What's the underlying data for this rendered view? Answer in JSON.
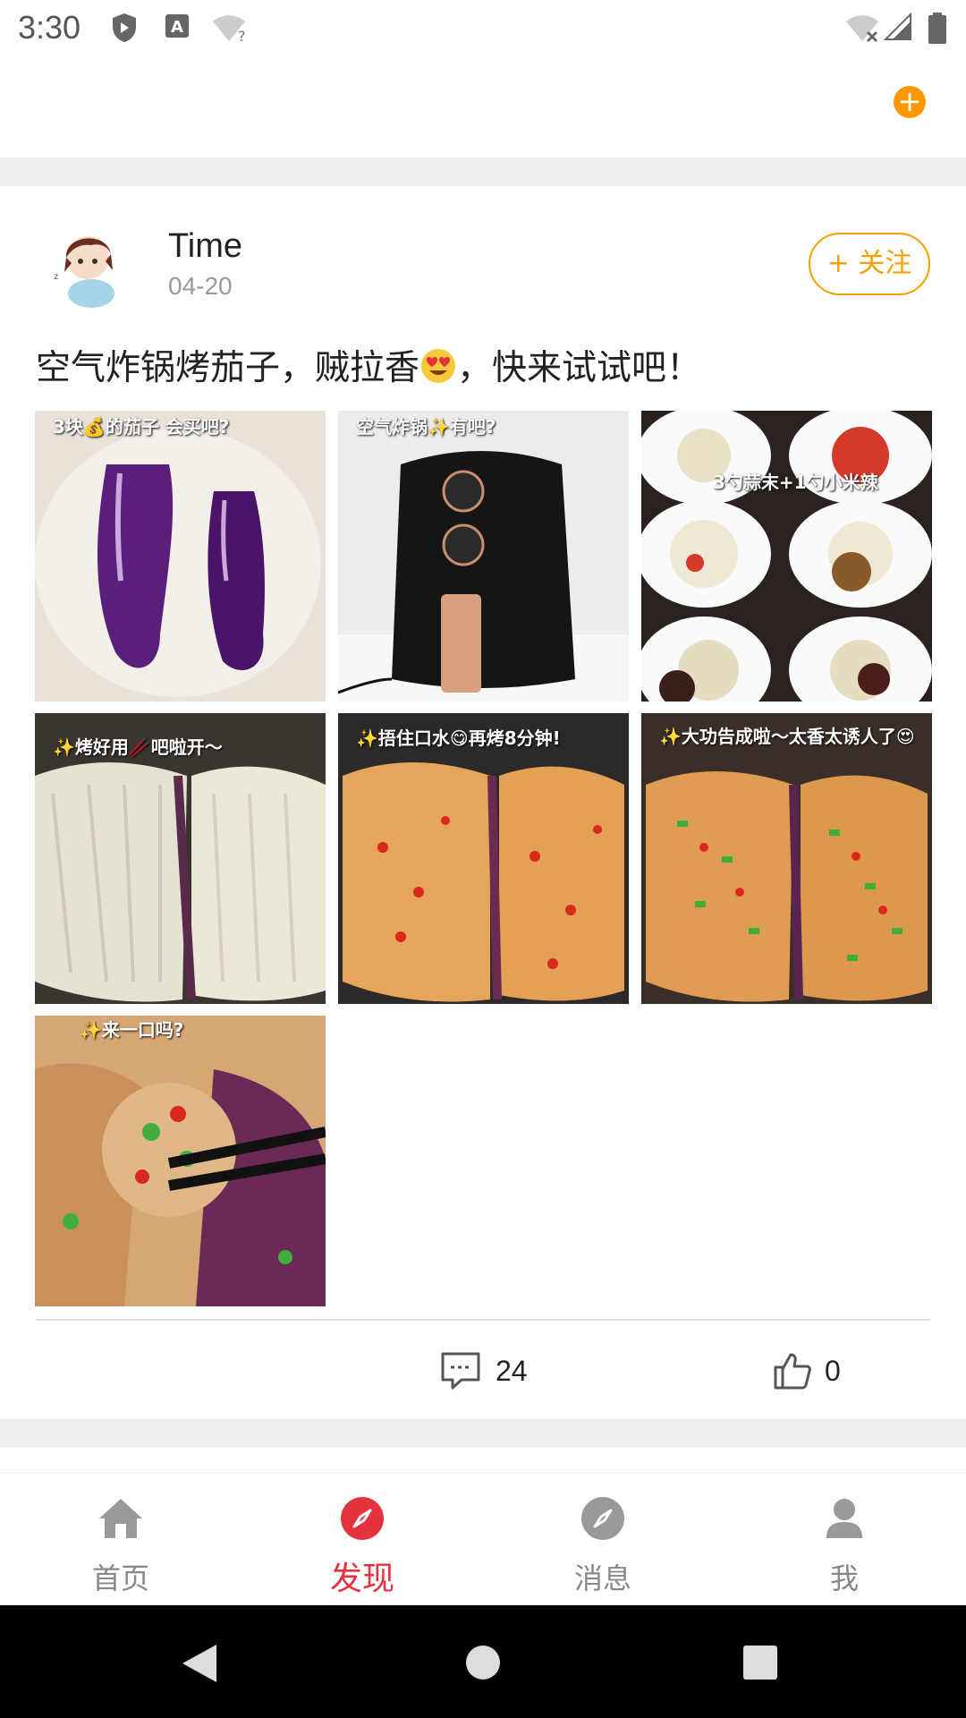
{
  "status_bar": {
    "time": "3:30"
  },
  "post": {
    "username": "Time",
    "date": "04-20",
    "follow_label": "+ 关注",
    "text_before": "空气炸锅烤茄子，贼拉香",
    "text_after": "，快来试试吧！",
    "photos": [
      {
        "caption": "3块💰的茄子 会买吧?"
      },
      {
        "caption": "空气炸锅✨有吧?"
      },
      {
        "caption": "3勺蒜末+1勺小米辣"
      },
      {
        "caption": "✨烤好用🥢吧啦开～"
      },
      {
        "caption": "✨捂住口水😋再烤8分钟!"
      },
      {
        "caption": "✨大功告成啦～太香太诱人了😍"
      },
      {
        "caption": "✨来一口吗?"
      }
    ],
    "comment_count": "24",
    "like_count": "0"
  },
  "bottom_nav": {
    "items": [
      {
        "label": "首页",
        "icon": "home-icon"
      },
      {
        "label": "发现",
        "icon": "compass-icon"
      },
      {
        "label": "消息",
        "icon": "compass-icon"
      },
      {
        "label": "我",
        "icon": "user-icon"
      }
    ],
    "active": 1
  },
  "colors": {
    "accent_red": "#e5323f",
    "follow_orange": "#f5a000",
    "add_orange": "#ff9800"
  }
}
